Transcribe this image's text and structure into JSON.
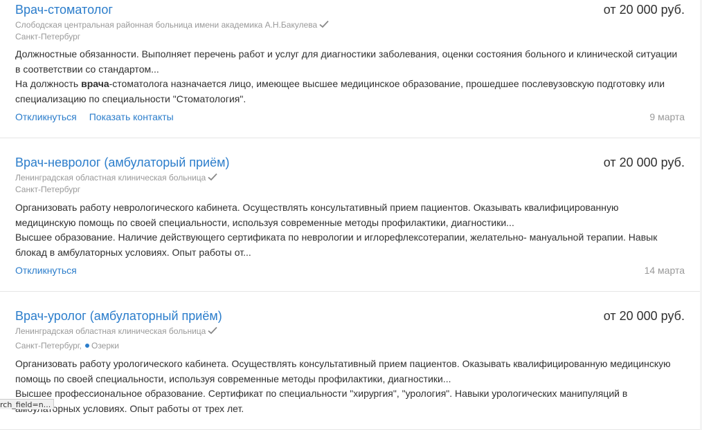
{
  "vacancies": [
    {
      "title": "Врач-стоматолог",
      "salary": "от 20 000 руб.",
      "employer": "Слободская центральная районная больница имени академика А.Н.Бакулева",
      "city": "Санкт-Петербург",
      "metro": "",
      "desc1": "Должностные обязанности. Выполняет перечень работ и услуг для диагностики заболевания, оценки состояния больного и клинической ситуации в соответствии со стандартом...",
      "desc2_prefix": "На должность ",
      "desc2_bold": "врача",
      "desc2_suffix": "-стоматолога назначается лицо, имеющее высшее медицинское образование, прошедшее послевузовскую подготовку или специализацию по специальности \"Стоматология\".",
      "respond_label": "Откликнуться",
      "contacts_label": "Показать контакты",
      "date": "9 марта"
    },
    {
      "title": "Врач-невролог (амбулаторый приём)",
      "salary": "от 20 000 руб.",
      "employer": "Ленинградская областная клиническая больница",
      "city": "Санкт-Петербург",
      "metro": "",
      "desc1": "Организовать работу неврологического кабинета. Осуществлять консультативный прием пациентов. Оказывать квалифицированную медицинскую помощь по своей специальности, используя современные методы профилактики, диагностики...",
      "desc2": "Высшее образование. Наличие действующего сертификата по неврологии и иглорефлексотерапии, желательно- мануальной терапии. Навык блокад в амбулаторных условиях. Опыт работы от...",
      "respond_label": "Откликнуться",
      "date": "14 марта"
    },
    {
      "title": "Врач-уролог (амбулаторный приём)",
      "salary": "от 20 000 руб.",
      "employer": "Ленинградская областная клиническая больница",
      "city": "Санкт-Петербург,",
      "metro": "Озерки",
      "desc1": "Организовать работу урологического кабинета. Осуществлять консультативный прием пациентов. Оказывать квалифицированную медицинскую помощь по своей специальности, используя современные методы профилактики, диагностики...",
      "desc2": "Высшее профессиональное образование. Сертификат по специальности \"хирургия\", \"урология\". Навыки урологических манипуляций в амбулаторных условиях. Опыт работы от трех лет."
    }
  ],
  "status_bar": "rch_field=n...",
  "colors": {
    "link": "#2b7dcb",
    "muted": "#999999",
    "text": "#303030"
  }
}
